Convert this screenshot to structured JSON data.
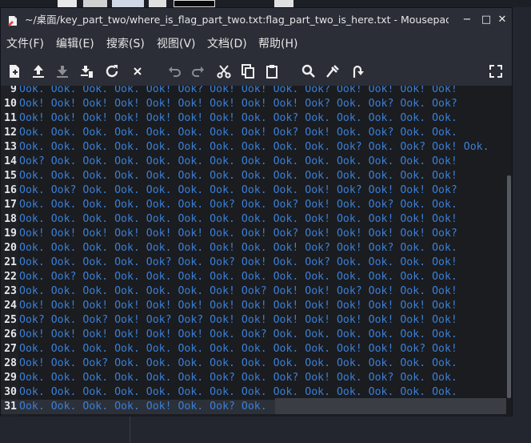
{
  "window": {
    "title": "~/桌面/key_part_two/where_is_flag_part_two.txt:flag_part_two_is_here.txt - Mousepad",
    "minimize": "−",
    "maximize": "□",
    "close": "✕"
  },
  "menu": [
    {
      "label": "文件(F)"
    },
    {
      "label": "编辑(E)"
    },
    {
      "label": "搜索(S)"
    },
    {
      "label": "视图(V)"
    },
    {
      "label": "文档(D)"
    },
    {
      "label": "帮助(H)"
    }
  ],
  "toolbar_icons": [
    "new-document-icon",
    "open-file-icon",
    "save-icon",
    "save-as-icon",
    "reload-icon",
    "close-document-icon",
    "undo-icon",
    "redo-icon",
    "cut-icon",
    "copy-icon",
    "paste-icon",
    "search-icon",
    "find-replace-icon",
    "goto-line-icon",
    "fullscreen-icon"
  ],
  "editor": {
    "lines": [
      {
        "num": "9",
        "text": "Ook. Ook. Ook. Ook. Ook! Ook? Ook! Ook! Ook. Ook? Ook! Ook! Ook! Ook!"
      },
      {
        "num": "10",
        "text": "Ook! Ook! Ook! Ook! Ook! Ook! Ook! Ook! Ook! Ook? Ook. Ook? Ook. Ook?"
      },
      {
        "num": "11",
        "text": "Ook! Ook! Ook! Ook! Ook! Ook! Ook! Ook. Ook? Ook. Ook. Ook. Ook. Ook."
      },
      {
        "num": "12",
        "text": "Ook. Ook. Ook. Ook. Ook. Ook. Ook. Ook! Ook? Ook! Ook. Ook? Ook. Ook."
      },
      {
        "num": "13",
        "text": "Ook. Ook. Ook. Ook. Ook. Ook. Ook. Ook. Ook. Ook. Ook? Ook. Ook? Ook! Ook."
      },
      {
        "num": "14",
        "text": "Ook? Ook. Ook. Ook. Ook. Ook. Ook. Ook. Ook. Ook. Ook. Ook. Ook. Ook!"
      },
      {
        "num": "15",
        "text": "Ook. Ook. Ook. Ook. Ook. Ook. Ook. Ook. Ook. Ook. Ook. Ook. Ook. Ook!"
      },
      {
        "num": "16",
        "text": "Ook. Ook? Ook. Ook. Ook. Ook. Ook. Ook. Ook. Ook! Ook? Ook! Ook! Ook?"
      },
      {
        "num": "17",
        "text": "Ook. Ook. Ook. Ook. Ook. Ook. Ook? Ook. Ook? Ook! Ook. Ook? Ook. Ook."
      },
      {
        "num": "18",
        "text": "Ook. Ook. Ook. Ook. Ook. Ook. Ook. Ook. Ook. Ook! Ook. Ook! Ook! Ook!"
      },
      {
        "num": "19",
        "text": "Ook! Ook! Ook! Ook! Ook! Ook! Ook. Ook! Ook? Ook! Ook! Ook! Ook! Ook?"
      },
      {
        "num": "20",
        "text": "Ook. Ook. Ook. Ook. Ook. Ook. Ook! Ook. Ook! Ook? Ook! Ook? Ook. Ook."
      },
      {
        "num": "21",
        "text": "Ook. Ook. Ook. Ook. Ook? Ook. Ook? Ook! Ook. Ook? Ook. Ook. Ook. Ook!"
      },
      {
        "num": "22",
        "text": "Ook. Ook? Ook. Ook. Ook. Ook. Ook. Ook. Ook. Ook. Ook. Ook. Ook. Ook."
      },
      {
        "num": "23",
        "text": "Ook. Ook. Ook. Ook. Ook. Ook. Ook! Ook? Ook! Ook! Ook? Ook! Ook. Ook!"
      },
      {
        "num": "24",
        "text": "Ook! Ook! Ook! Ook! Ook! Ook! Ook! Ook! Ook! Ook! Ook! Ook! Ook! Ook!"
      },
      {
        "num": "25",
        "text": "Ook? Ook. Ook? Ook! Ook? Ook? Ook! Ook! Ook! Ook! Ook! Ook! Ook! Ook!"
      },
      {
        "num": "26",
        "text": "Ook! Ook! Ook! Ook! Ook! Ook! Ook. Ook? Ook. Ook. Ook. Ook. Ook. Ook."
      },
      {
        "num": "27",
        "text": "Ook. Ook. Ook. Ook. Ook. Ook. Ook. Ook. Ook. Ook. Ook! Ook! Ook? Ook!"
      },
      {
        "num": "28",
        "text": "Ook! Ook. Ook? Ook. Ook. Ook. Ook. Ook. Ook. Ook. Ook. Ook. Ook. Ook."
      },
      {
        "num": "29",
        "text": "Ook. Ook. Ook. Ook. Ook. Ook. Ook? Ook. Ook? Ook! Ook. Ook? Ook. Ook."
      },
      {
        "num": "30",
        "text": "Ook. Ook. Ook. Ook. Ook. Ook. Ook. Ook. Ook. Ook. Ook. Ook. Ook. Ook."
      },
      {
        "num": "31",
        "text": "Ook. Ook. Ook. Ook. Ook! Ook. Ook? Ook."
      }
    ],
    "current_line": "31"
  },
  "colors": {
    "text": "#3b7fd6",
    "line_number": "#e8e8e8",
    "editor_bg": "#1a1c20",
    "chrome_bg": "#2b2e37"
  }
}
